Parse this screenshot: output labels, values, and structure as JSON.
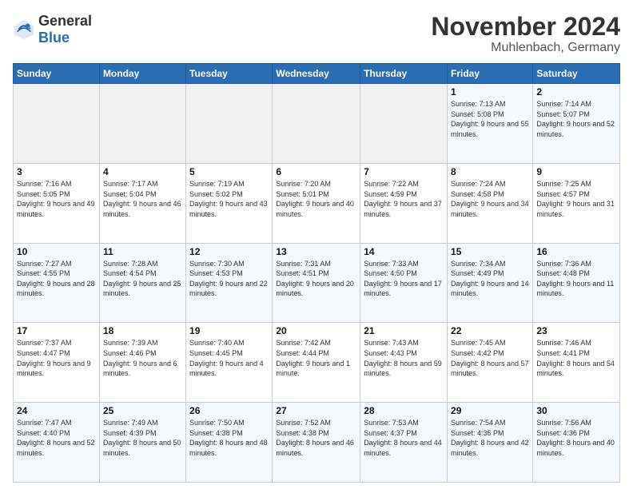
{
  "logo": {
    "general": "General",
    "blue": "Blue"
  },
  "title": "November 2024",
  "location": "Muhlenbach, Germany",
  "weekdays": [
    "Sunday",
    "Monday",
    "Tuesday",
    "Wednesday",
    "Thursday",
    "Friday",
    "Saturday"
  ],
  "weeks": [
    [
      {
        "day": "",
        "info": ""
      },
      {
        "day": "",
        "info": ""
      },
      {
        "day": "",
        "info": ""
      },
      {
        "day": "",
        "info": ""
      },
      {
        "day": "",
        "info": ""
      },
      {
        "day": "1",
        "info": "Sunrise: 7:13 AM\nSunset: 5:08 PM\nDaylight: 9 hours and 55 minutes."
      },
      {
        "day": "2",
        "info": "Sunrise: 7:14 AM\nSunset: 5:07 PM\nDaylight: 9 hours and 52 minutes."
      }
    ],
    [
      {
        "day": "3",
        "info": "Sunrise: 7:16 AM\nSunset: 5:05 PM\nDaylight: 9 hours and 49 minutes."
      },
      {
        "day": "4",
        "info": "Sunrise: 7:17 AM\nSunset: 5:04 PM\nDaylight: 9 hours and 46 minutes."
      },
      {
        "day": "5",
        "info": "Sunrise: 7:19 AM\nSunset: 5:02 PM\nDaylight: 9 hours and 43 minutes."
      },
      {
        "day": "6",
        "info": "Sunrise: 7:20 AM\nSunset: 5:01 PM\nDaylight: 9 hours and 40 minutes."
      },
      {
        "day": "7",
        "info": "Sunrise: 7:22 AM\nSunset: 4:59 PM\nDaylight: 9 hours and 37 minutes."
      },
      {
        "day": "8",
        "info": "Sunrise: 7:24 AM\nSunset: 4:58 PM\nDaylight: 9 hours and 34 minutes."
      },
      {
        "day": "9",
        "info": "Sunrise: 7:25 AM\nSunset: 4:57 PM\nDaylight: 9 hours and 31 minutes."
      }
    ],
    [
      {
        "day": "10",
        "info": "Sunrise: 7:27 AM\nSunset: 4:55 PM\nDaylight: 9 hours and 28 minutes."
      },
      {
        "day": "11",
        "info": "Sunrise: 7:28 AM\nSunset: 4:54 PM\nDaylight: 9 hours and 25 minutes."
      },
      {
        "day": "12",
        "info": "Sunrise: 7:30 AM\nSunset: 4:53 PM\nDaylight: 9 hours and 22 minutes."
      },
      {
        "day": "13",
        "info": "Sunrise: 7:31 AM\nSunset: 4:51 PM\nDaylight: 9 hours and 20 minutes."
      },
      {
        "day": "14",
        "info": "Sunrise: 7:33 AM\nSunset: 4:50 PM\nDaylight: 9 hours and 17 minutes."
      },
      {
        "day": "15",
        "info": "Sunrise: 7:34 AM\nSunset: 4:49 PM\nDaylight: 9 hours and 14 minutes."
      },
      {
        "day": "16",
        "info": "Sunrise: 7:36 AM\nSunset: 4:48 PM\nDaylight: 9 hours and 11 minutes."
      }
    ],
    [
      {
        "day": "17",
        "info": "Sunrise: 7:37 AM\nSunset: 4:47 PM\nDaylight: 9 hours and 9 minutes."
      },
      {
        "day": "18",
        "info": "Sunrise: 7:39 AM\nSunset: 4:46 PM\nDaylight: 9 hours and 6 minutes."
      },
      {
        "day": "19",
        "info": "Sunrise: 7:40 AM\nSunset: 4:45 PM\nDaylight: 9 hours and 4 minutes."
      },
      {
        "day": "20",
        "info": "Sunrise: 7:42 AM\nSunset: 4:44 PM\nDaylight: 9 hours and 1 minute."
      },
      {
        "day": "21",
        "info": "Sunrise: 7:43 AM\nSunset: 4:43 PM\nDaylight: 8 hours and 59 minutes."
      },
      {
        "day": "22",
        "info": "Sunrise: 7:45 AM\nSunset: 4:42 PM\nDaylight: 8 hours and 57 minutes."
      },
      {
        "day": "23",
        "info": "Sunrise: 7:46 AM\nSunset: 4:41 PM\nDaylight: 8 hours and 54 minutes."
      }
    ],
    [
      {
        "day": "24",
        "info": "Sunrise: 7:47 AM\nSunset: 4:40 PM\nDaylight: 8 hours and 52 minutes."
      },
      {
        "day": "25",
        "info": "Sunrise: 7:49 AM\nSunset: 4:39 PM\nDaylight: 8 hours and 50 minutes."
      },
      {
        "day": "26",
        "info": "Sunrise: 7:50 AM\nSunset: 4:38 PM\nDaylight: 8 hours and 48 minutes."
      },
      {
        "day": "27",
        "info": "Sunrise: 7:52 AM\nSunset: 4:38 PM\nDaylight: 8 hours and 46 minutes."
      },
      {
        "day": "28",
        "info": "Sunrise: 7:53 AM\nSunset: 4:37 PM\nDaylight: 8 hours and 44 minutes."
      },
      {
        "day": "29",
        "info": "Sunrise: 7:54 AM\nSunset: 4:36 PM\nDaylight: 8 hours and 42 minutes."
      },
      {
        "day": "30",
        "info": "Sunrise: 7:56 AM\nSunset: 4:36 PM\nDaylight: 8 hours and 40 minutes."
      }
    ]
  ]
}
